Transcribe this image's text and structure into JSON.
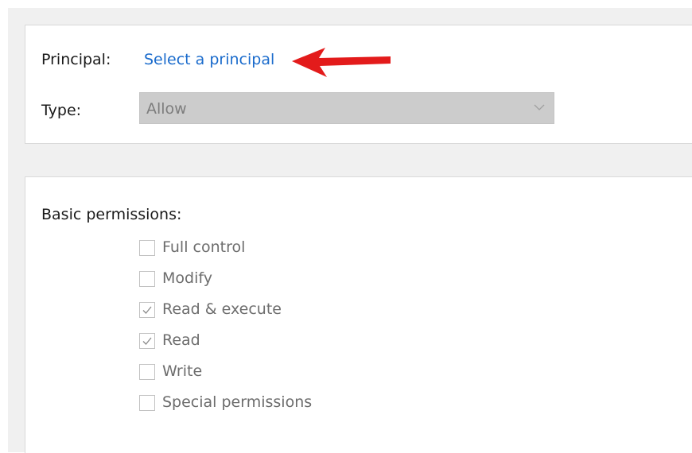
{
  "principal": {
    "label": "Principal:",
    "link": "Select a principal"
  },
  "type": {
    "label": "Type:",
    "value": "Allow"
  },
  "permissions": {
    "title": "Basic permissions:",
    "items": [
      {
        "label": "Full control",
        "checked": false
      },
      {
        "label": "Modify",
        "checked": false
      },
      {
        "label": "Read & execute",
        "checked": true
      },
      {
        "label": "Read",
        "checked": true
      },
      {
        "label": "Write",
        "checked": false
      },
      {
        "label": "Special permissions",
        "checked": false
      }
    ]
  },
  "colors": {
    "link": "#1a6bcc",
    "annotation_arrow": "#e31b1b"
  }
}
